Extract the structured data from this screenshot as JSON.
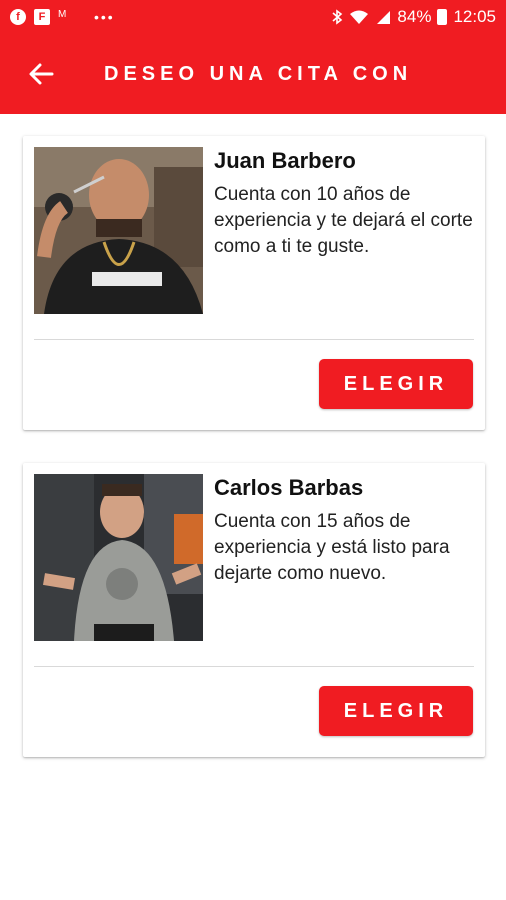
{
  "status_bar": {
    "icons": [
      "facebook-icon",
      "flipboard-icon",
      "gmail-icon",
      "more-dots-icon",
      "bluetooth-icon",
      "wifi-icon",
      "signal-icon",
      "battery-icon"
    ],
    "battery": "84%",
    "time": "12:05"
  },
  "header": {
    "title": "DESEO UNA CITA CON"
  },
  "barbers": [
    {
      "name": "Juan Barbero",
      "description": "Cuenta con 10 años de experiencia y te dejará el corte como a ti te guste.",
      "button_label": "ELEGIR"
    },
    {
      "name": "Carlos Barbas",
      "description": "Cuenta con 15 años de experiencia y está listo para dejarte como nuevo.",
      "button_label": "ELEGIR"
    }
  ],
  "colors": {
    "primary": "#f01c22",
    "text": "#111111",
    "card_bg": "#ffffff"
  }
}
